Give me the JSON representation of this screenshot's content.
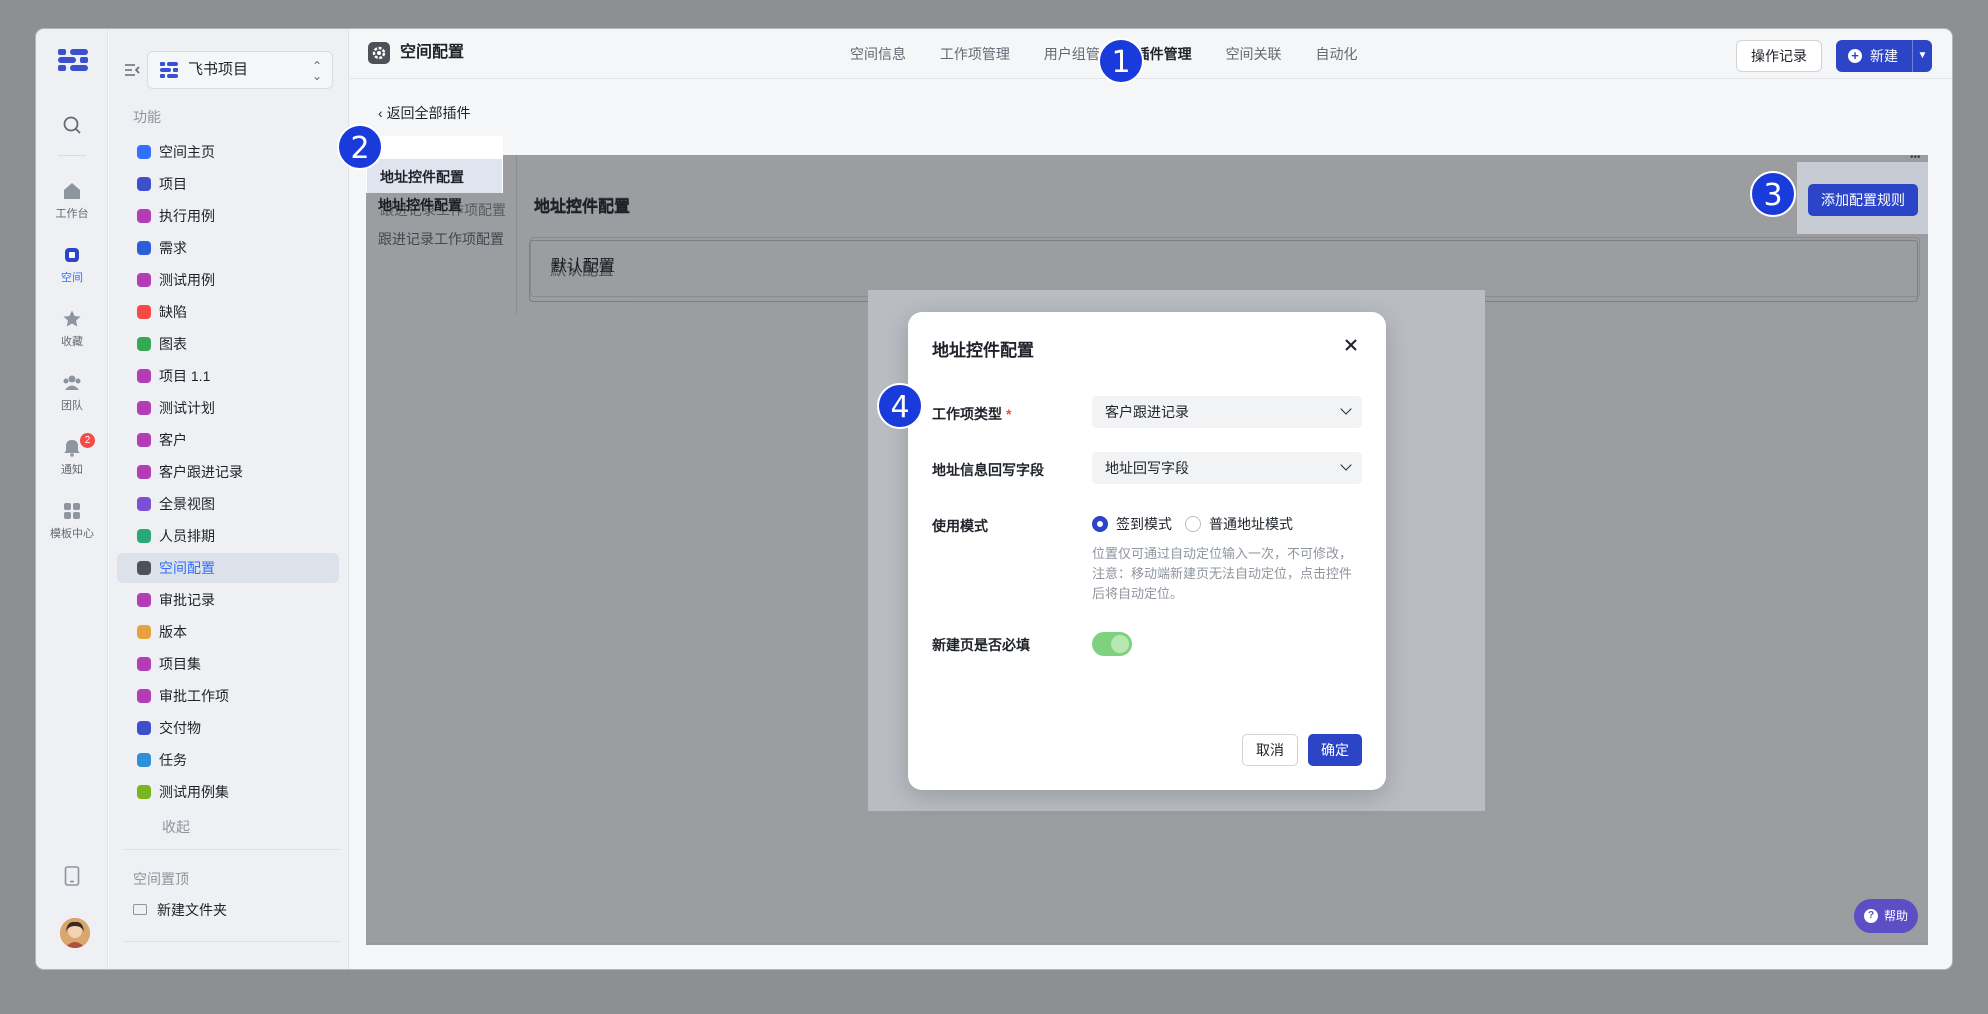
{
  "window": {
    "title": "空间配置"
  },
  "rail": {
    "items": [
      {
        "label": "",
        "icon": "search-icon"
      },
      {
        "label": "工作台",
        "icon": "home-icon"
      },
      {
        "label": "空间",
        "icon": "space-icon",
        "active": true
      },
      {
        "label": "收藏",
        "icon": "star-icon"
      },
      {
        "label": "团队",
        "icon": "team-icon"
      },
      {
        "label": "通知",
        "icon": "bell-icon",
        "badge": "2"
      },
      {
        "label": "模板中心",
        "icon": "template-icon"
      }
    ]
  },
  "sidebar": {
    "project_name": "飞书项目",
    "section_title": "功能",
    "items": [
      {
        "label": "空间主页",
        "color": "#3370ff"
      },
      {
        "label": "项目",
        "color": "#3b4fcf"
      },
      {
        "label": "执行用例",
        "color": "#b33db5"
      },
      {
        "label": "需求",
        "color": "#2b5fd9"
      },
      {
        "label": "测试用例",
        "color": "#b33db5"
      },
      {
        "label": "缺陷",
        "color": "#f54a45"
      },
      {
        "label": "图表",
        "color": "#34a853"
      },
      {
        "label": "项目 1.1",
        "color": "#b33db5"
      },
      {
        "label": "测试计划",
        "color": "#b33db5"
      },
      {
        "label": "客户",
        "color": "#b33db5"
      },
      {
        "label": "客户跟进记录",
        "color": "#b33db5"
      },
      {
        "label": "全景视图",
        "color": "#7b4fd6"
      },
      {
        "label": "人员排期",
        "color": "#2aa876"
      },
      {
        "label": "空间配置",
        "color": "#4e5258",
        "active": true
      },
      {
        "label": "审批记录",
        "color": "#b33db5"
      },
      {
        "label": "版本",
        "color": "#e6a23c"
      },
      {
        "label": "项目集",
        "color": "#b33db5"
      },
      {
        "label": "审批工作项",
        "color": "#b33db5"
      },
      {
        "label": "交付物",
        "color": "#3b4fcf"
      },
      {
        "label": "任务",
        "color": "#2f8fd8"
      },
      {
        "label": "测试用例集",
        "color": "#7ab51d"
      }
    ],
    "fold_label": "收起",
    "pinned_title": "空间置顶",
    "new_folder_label": "新建文件夹"
  },
  "topbar": {
    "tabs": [
      {
        "label": "空间信息"
      },
      {
        "label": "工作项管理"
      },
      {
        "label": "用户组管"
      },
      {
        "label": "插件管理",
        "active": true
      },
      {
        "label": "空间关联"
      },
      {
        "label": "自动化"
      }
    ],
    "log_button": "操作记录",
    "new_button": "新建"
  },
  "content": {
    "back_link": "返回全部插件",
    "plugin_tabs": [
      {
        "label": "地址控件配置",
        "active": true
      },
      {
        "label": "跟进记录工作项配置"
      }
    ],
    "panel_title": "地址控件配置",
    "add_rule_button": "添加配置规则",
    "default_config": "默认配置"
  },
  "modal": {
    "title": "地址控件配置",
    "field_type_label": "工作项类型",
    "field_type_required": "*",
    "field_type_value": "客户跟进记录",
    "writeback_label": "地址信息回写字段",
    "writeback_value": "地址回写字段",
    "mode_label": "使用模式",
    "mode_options": [
      {
        "label": "签到模式",
        "checked": true
      },
      {
        "label": "普通地址模式",
        "checked": false
      }
    ],
    "mode_hint": "位置仅可通过自动定位输入一次，不可修改，注意：移动端新建页无法自动定位，点击控件后将自动定位。",
    "required_label": "新建页是否必填",
    "required_on": true,
    "cancel_button": "取消",
    "ok_button": "确定"
  },
  "markers": [
    "1",
    "2",
    "3",
    "4"
  ],
  "help_label": "帮助",
  "colors": {
    "accent": "#2b45c6",
    "marker": "#1a3bdc",
    "toggle": "#7fd180"
  }
}
